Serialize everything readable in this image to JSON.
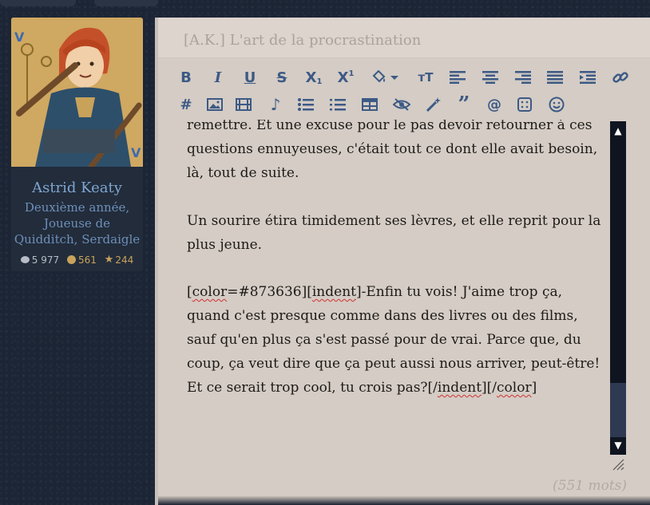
{
  "profile": {
    "name": "Astrid Keaty",
    "title_lines": [
      "Deuxième année,",
      "Joueuse de",
      "Quidditch, Serdaigle"
    ],
    "stats": {
      "messages": "5 977",
      "points": "561",
      "stars": "244"
    }
  },
  "editor": {
    "subject": "[A.K.] L'art de la procrastination",
    "toolbar": [
      "bold-icon",
      "italic-icon",
      "underline-icon",
      "strikethrough-icon",
      "subscript-icon",
      "superscript-icon",
      "fill-color-icon",
      "font-size-icon",
      "align-left-icon",
      "align-center-icon",
      "align-right-icon",
      "justify-icon",
      "indent-icon",
      "link-icon",
      "hashtag-icon",
      "image-icon",
      "video-icon",
      "music-icon",
      "bullet-list-icon",
      "numbered-list-icon",
      "table-icon",
      "hide-icon",
      "magic-wand-icon",
      "quote-icon",
      "mention-icon",
      "dice-icon",
      "emoji-icon"
    ],
    "content": {
      "p1": [
        "remettre. Et une excuse pour le pas devoir retourner à ces",
        "questions ennuyeuses, c'était tout ce dont elle avait besoin,",
        "là, tout de suite."
      ],
      "p2": [
        "Un sourire étira timidement ses lèvres, et elle reprit pour la",
        "plus jeune."
      ],
      "p3_l1": {
        "a": "[",
        "b": "color",
        "c": "=#873636][",
        "d": "indent",
        "e": "]-Enfin tu vois! J'aime trop ça,"
      },
      "p3": [
        "quand c'est presque comme dans des livres ou des films,",
        "sauf qu'en plus ça s'est passé pour de vrai. Parce que, du",
        "coup, ça veut dire que ça peut aussi nous arriver, peut-être!"
      ],
      "p3_last": {
        "a": "Et ce serait trop cool, tu crois pas?[/",
        "b": "indent",
        "c": "][/",
        "d": "color",
        "e": "]"
      }
    },
    "word_count": "(551 mots)"
  }
}
